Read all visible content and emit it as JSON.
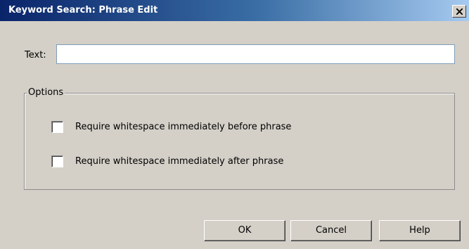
{
  "window": {
    "title": "Keyword Search: Phrase Edit",
    "close_icon": "close-icon"
  },
  "form": {
    "text_label": "Text:",
    "text_value": "",
    "text_placeholder": ""
  },
  "options": {
    "legend": "Options",
    "items": [
      {
        "label": "Require whitespace immediately before phrase",
        "checked": false
      },
      {
        "label": "Require whitespace immediately after phrase",
        "checked": false
      }
    ]
  },
  "buttons": {
    "ok": "OK",
    "cancel": "Cancel",
    "help": "Help"
  },
  "colors": {
    "dialog_bg": "#d4d0c8",
    "title_gradient_start": "#0a246a",
    "title_gradient_end": "#a6caf0",
    "title_text": "#ffffff"
  }
}
